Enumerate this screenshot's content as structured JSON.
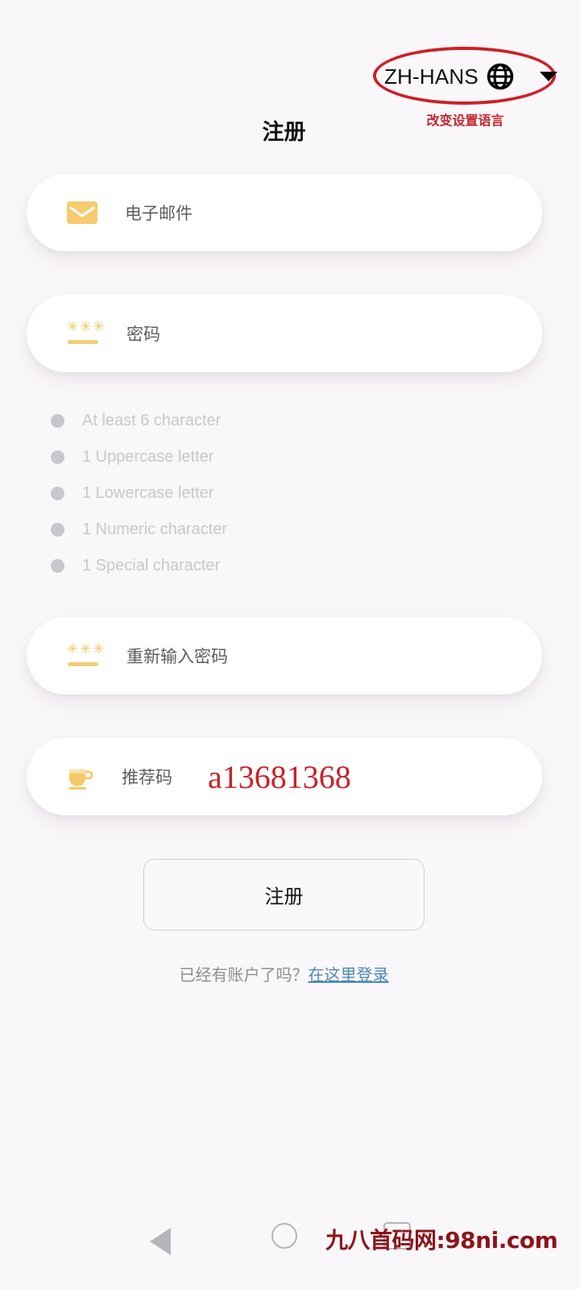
{
  "language_selector": {
    "code": "ZH-HANS",
    "globe_icon": "globe-icon",
    "caret_icon": "chevron-down-icon",
    "annotation_note": "改变设置语言",
    "annotation_color": "#cc2027"
  },
  "header": {
    "title": "注册"
  },
  "form": {
    "email": {
      "icon": "envelope-icon",
      "placeholder": "电子邮件",
      "value": ""
    },
    "password": {
      "icon": "password-asterisks-icon",
      "placeholder": "密码",
      "value": ""
    },
    "confirm_password": {
      "icon": "password-asterisks-icon",
      "placeholder": "重新输入密码",
      "value": ""
    },
    "referral_code": {
      "icon": "coffee-cup-icon",
      "placeholder": "推荐码",
      "value": "a13681368",
      "value_color": "#cc2026"
    }
  },
  "password_requirements": [
    {
      "bullet": "bullet-dot",
      "text": "At least 6 character",
      "met": false
    },
    {
      "bullet": "bullet-dot",
      "text": "1 Uppercase letter",
      "met": false
    },
    {
      "bullet": "bullet-dot",
      "text": "1 Lowercase letter",
      "met": false
    },
    {
      "bullet": "bullet-dot",
      "text": "1 Numeric character",
      "met": false
    },
    {
      "bullet": "bullet-dot",
      "text": "1 Special character",
      "met": false
    }
  ],
  "actions": {
    "register_label": "注册",
    "login_prompt": "已经有账户了吗？",
    "login_link_label": "在这里登录",
    "login_link_color": "#4a87b8"
  },
  "navbar": {
    "back_icon": "triangle-back-icon",
    "home_icon": "circle-home-icon",
    "recent_icon": "square-recents-icon",
    "watermark": "九八首码网:98ni.com",
    "watermark_color": "#8b1518"
  },
  "theme": {
    "background": "#faf7fa",
    "card_background": "#ffffff",
    "accent_amber": "#f6c96a",
    "label_text": "#5d5d63",
    "requirement_text": "#c9c7cd"
  }
}
